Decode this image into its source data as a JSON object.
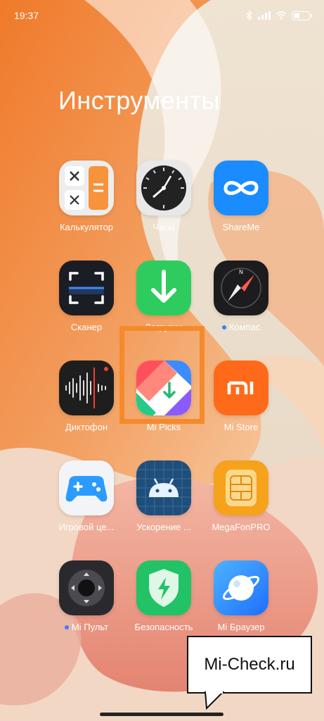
{
  "status_bar": {
    "time": "19:37"
  },
  "folder": {
    "title": "Инструменты"
  },
  "apps": [
    {
      "label": "Калькулятор",
      "icon": "calculator-icon",
      "dot": false
    },
    {
      "label": "Часы",
      "icon": "clock-icon",
      "dot": false
    },
    {
      "label": "ShareMe",
      "icon": "shareme-icon",
      "dot": false
    },
    {
      "label": "Сканер",
      "icon": "scanner-icon",
      "dot": false
    },
    {
      "label": "Загрузки",
      "icon": "downloads-icon",
      "dot": false
    },
    {
      "label": "Компас",
      "icon": "compass-icon",
      "dot": true
    },
    {
      "label": "Диктофон",
      "icon": "recorder-icon",
      "dot": false
    },
    {
      "label": "Mi Picks",
      "icon": "mi-picks-icon",
      "dot": false
    },
    {
      "label": "Mi Store",
      "icon": "mi-store-icon",
      "dot": false
    },
    {
      "label": "Игровой це...",
      "icon": "gamepad-icon",
      "dot": false
    },
    {
      "label": "Ускорение ...",
      "icon": "android-icon",
      "dot": false
    },
    {
      "label": "MegaFonPRO",
      "icon": "sim-card-icon",
      "dot": false
    },
    {
      "label": "Mi Пульт",
      "icon": "remote-icon",
      "dot": true
    },
    {
      "label": "Безопасность",
      "icon": "security-shield-icon",
      "dot": false
    },
    {
      "label": "Mi Браузер",
      "icon": "browser-icon",
      "dot": false
    }
  ],
  "watermark": {
    "text": "Mi-Check.ru"
  },
  "colors": {
    "highlight": "#f58a2d",
    "notification_dot": "#3d7bff"
  }
}
